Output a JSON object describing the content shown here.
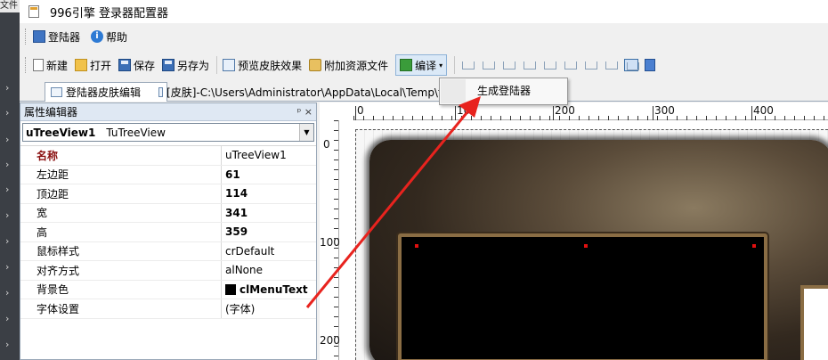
{
  "window": {
    "title": "996引擎 登录器配置器",
    "left_strip_text": "文件"
  },
  "menu": {
    "items": [
      "登陆器",
      "帮助"
    ]
  },
  "toolbar": {
    "new": "新建",
    "open": "打开",
    "save": "保存",
    "save_as": "另存为",
    "preview": "预览皮肤效果",
    "attach": "附加资源文件",
    "compile": "编译"
  },
  "tabs": [
    {
      "label": "登陆器皮肤编辑"
    },
    {
      "label": "[皮肤]-C:\\Users\\Administrator\\AppData\\Local\\Temp\\tmp"
    }
  ],
  "dropdown": {
    "item": "生成登陆器"
  },
  "property_editor": {
    "title": "属性编辑器",
    "pin_close": "ᵖ ×",
    "component_name": "uTreeView1",
    "component_type": "TuTreeView",
    "rows": [
      {
        "key": "名称",
        "value": "uTreeView1"
      },
      {
        "key": "左边距",
        "value": "61"
      },
      {
        "key": "顶边距",
        "value": "114"
      },
      {
        "key": "宽",
        "value": "341"
      },
      {
        "key": "高",
        "value": "359"
      },
      {
        "key": "鼠标样式",
        "value": "crDefault"
      },
      {
        "key": "对齐方式",
        "value": "alNone"
      },
      {
        "key": "背景色",
        "value": "clMenuText"
      },
      {
        "key": "字体设置",
        "value": "(字体)"
      }
    ]
  },
  "ruler": {
    "top_labels": [
      "0",
      "100",
      "200",
      "300",
      "400"
    ],
    "left_labels": [
      "0",
      "100",
      "200"
    ]
  },
  "colors": {
    "arrow": "#e8231e",
    "accent": "#3a6ea5"
  }
}
